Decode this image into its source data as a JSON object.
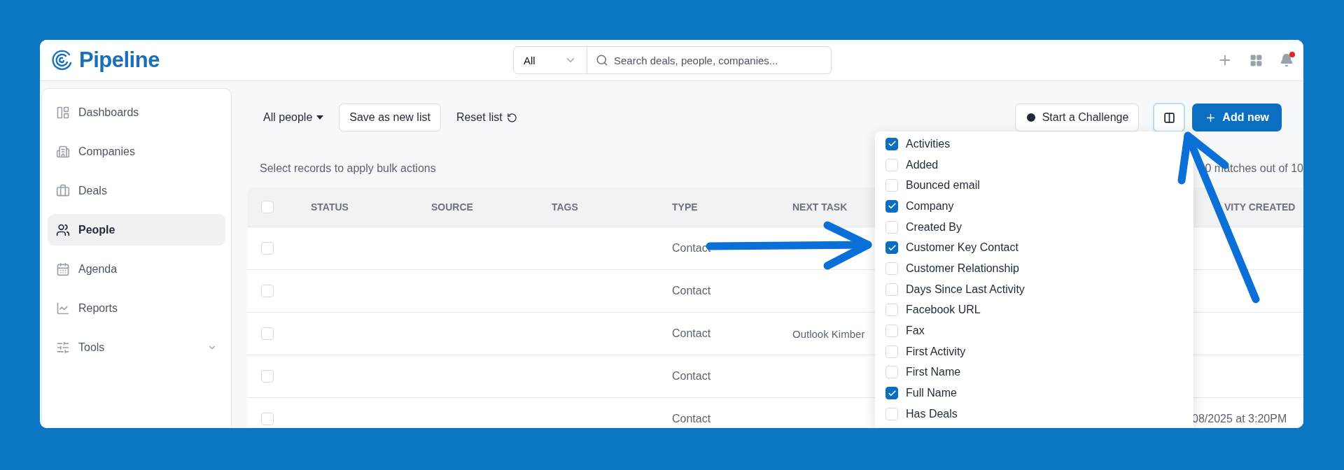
{
  "header": {
    "logo": "Pipeline",
    "search_scope": "All",
    "search": {
      "placeholder": "Search deals, people, companies..."
    },
    "notification_badge": true
  },
  "sidebar": {
    "items": [
      {
        "label": "Dashboards",
        "selected": false
      },
      {
        "label": "Companies",
        "selected": false
      },
      {
        "label": "Deals",
        "selected": false
      },
      {
        "label": "People",
        "selected": true
      },
      {
        "label": "Agenda",
        "selected": false
      },
      {
        "label": "Reports",
        "selected": false
      },
      {
        "label": "Tools",
        "selected": false
      }
    ]
  },
  "toolbar": {
    "list_selector": "All people",
    "save_button": "Save as new list",
    "reset_button": "Reset list",
    "challenge_button": "Start a Challenge",
    "add_button": "Add new"
  },
  "bulk_hint": "Select records to apply bulk actions",
  "match_count": "0 matches out of 10",
  "table": {
    "select_all_checked": false,
    "columns": [
      "STATUS",
      "SOURCE",
      "TAGS",
      "TYPE",
      "NEXT TASK",
      "VITY CREATED"
    ],
    "rows": [
      {
        "checked": false,
        "type": "Contact"
      },
      {
        "checked": false,
        "type": "Contact"
      },
      {
        "checked": false,
        "type": "Contact",
        "next_task": "Outlook Kimber"
      },
      {
        "checked": false,
        "type": "Contact"
      },
      {
        "checked": false,
        "type": "Contact",
        "last_activity": "08/2025 at 3:20PM"
      }
    ]
  },
  "column_picker": {
    "items": [
      {
        "label": "Activities",
        "checked": true
      },
      {
        "label": "Added",
        "checked": false
      },
      {
        "label": "Bounced email",
        "checked": false
      },
      {
        "label": "Company",
        "checked": true
      },
      {
        "label": "Created By",
        "checked": false
      },
      {
        "label": "Customer Key Contact",
        "checked": true
      },
      {
        "label": "Customer Relationship",
        "checked": false
      },
      {
        "label": "Days Since Last Activity",
        "checked": false
      },
      {
        "label": "Facebook URL",
        "checked": false
      },
      {
        "label": "Fax",
        "checked": false
      },
      {
        "label": "First Activity",
        "checked": false
      },
      {
        "label": "First Name",
        "checked": false
      },
      {
        "label": "Full Name",
        "checked": true
      },
      {
        "label": "Has Deals",
        "checked": false
      }
    ]
  }
}
